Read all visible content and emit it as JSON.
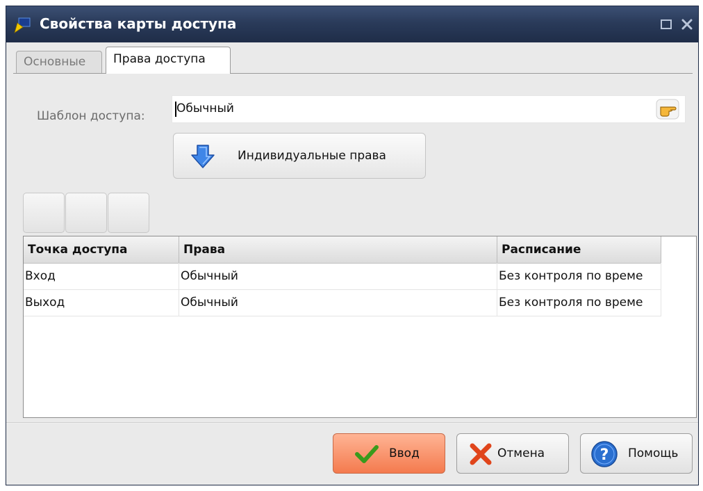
{
  "window": {
    "title": "Свойства карты доступа",
    "title_bar_color": "#2a3b5a"
  },
  "tabs": [
    {
      "label": "Основные",
      "active": false
    },
    {
      "label": "Права доступа",
      "active": true
    }
  ],
  "access_template": {
    "label": "Шаблон доступа:",
    "value": "Обычный"
  },
  "individual_rights_button": {
    "label": "Индивидуальные права"
  },
  "grid": {
    "columns": [
      "Точка доступа",
      "Права",
      "Расписание"
    ],
    "rows": [
      [
        "Вход",
        "Обычный",
        "Без контроля по време"
      ],
      [
        "Выход",
        "Обычный",
        "Без контроля по време"
      ]
    ]
  },
  "buttons": {
    "ok": "Ввод",
    "cancel": "Отмена",
    "help": "Помощь"
  },
  "colors": {
    "ok_button": "#f47a4e",
    "cancel_icon": "#e0451b",
    "help_icon": "#2a6fd0",
    "check_icon": "#3a9a1c"
  },
  "icons": {
    "app": "card-icon",
    "pick": "pointing-hand-icon",
    "individual": "arrow-down-icon",
    "ok": "checkmark-icon",
    "cancel": "cross-icon",
    "help": "question-icon"
  }
}
